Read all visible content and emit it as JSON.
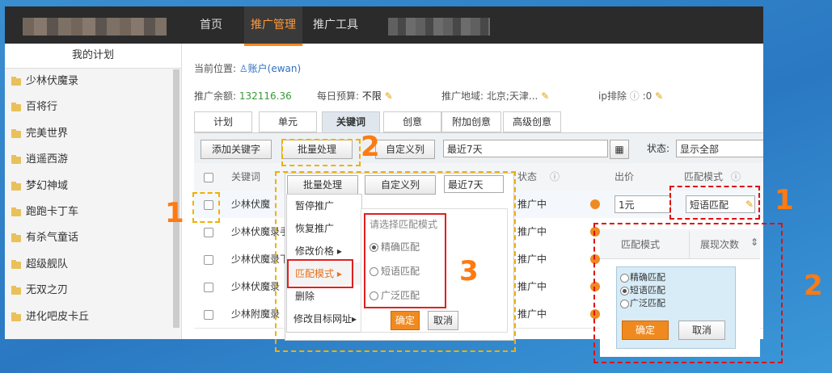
{
  "topbar": {
    "nav": [
      {
        "label": "首页",
        "active": false
      },
      {
        "label": "推广管理",
        "active": true
      },
      {
        "label": "推广工具",
        "active": false
      }
    ]
  },
  "sidebar": {
    "title": "我的计划",
    "items": [
      "少林伏魔录",
      "百将行",
      "完美世界",
      "逍遥西游",
      "梦幻神域",
      "跑跑卡丁车",
      "有杀气童话",
      "超级舰队",
      "无双之刃",
      "进化吧皮卡丘"
    ]
  },
  "breadcrumb": {
    "prefix": "当前位置:",
    "account": "账户(ewan)"
  },
  "info": {
    "balance_label": "推广余额:",
    "balance_value": "132116.36",
    "budget_label": "每日预算:",
    "budget_value": "不限",
    "region_label": "推广地域:",
    "region_value": "北京;天津...",
    "ip_label": "ip排除",
    "ip_value": ":0"
  },
  "tabs": [
    "计划",
    "单元",
    "关键词",
    "创意",
    "附加创意",
    "高级创意"
  ],
  "active_tab": "关键词",
  "toolbar": {
    "add_keyword": "添加关键字",
    "batch": "批量处理",
    "custom_columns": "自定义列",
    "date_range": "最近7天",
    "status_label": "状态:",
    "status_value": "显示全部"
  },
  "table": {
    "headers": {
      "keyword": "关键词",
      "status": "状态",
      "bid": "出价",
      "match": "匹配模式"
    },
    "rows": [
      {
        "keyword": "少林伏魔",
        "status": "推广中",
        "bid": "1元",
        "match": "短语匹配"
      },
      {
        "keyword": "少林伏魔录手",
        "status": "推广中"
      },
      {
        "keyword": "少林伏魔录下",
        "status": "推广中"
      },
      {
        "keyword": "少林伏魔录",
        "status": "推广中"
      },
      {
        "keyword": "少林附魔录",
        "status": "推广中"
      }
    ]
  },
  "popup": {
    "batch": "批量处理",
    "custom_columns": "自定义列",
    "date_range": "最近7天",
    "menu": [
      "暂停推广",
      "恢复推广",
      "修改价格",
      "匹配模式",
      "删除",
      "修改目标网址"
    ],
    "submenu_title": "请选择匹配模式",
    "options": [
      "精确匹配",
      "短语匹配",
      "广泛匹配"
    ],
    "selected": "精确匹配",
    "confirm": "确定",
    "cancel": "取消"
  },
  "right_panel": {
    "col1": "匹配模式",
    "col2": "展现次数",
    "options": [
      "精确匹配",
      "短语匹配",
      "广泛匹配"
    ],
    "selected": "短语匹配",
    "confirm": "确定",
    "cancel": "取消"
  },
  "annotations": {
    "n1": "1",
    "n2": "2",
    "n3": "3",
    "n1b": "1",
    "n2b": "2"
  },
  "colors": {
    "accent": "#f08a20",
    "highlight_yellow": "#f0b000",
    "highlight_red": "#e01010"
  }
}
